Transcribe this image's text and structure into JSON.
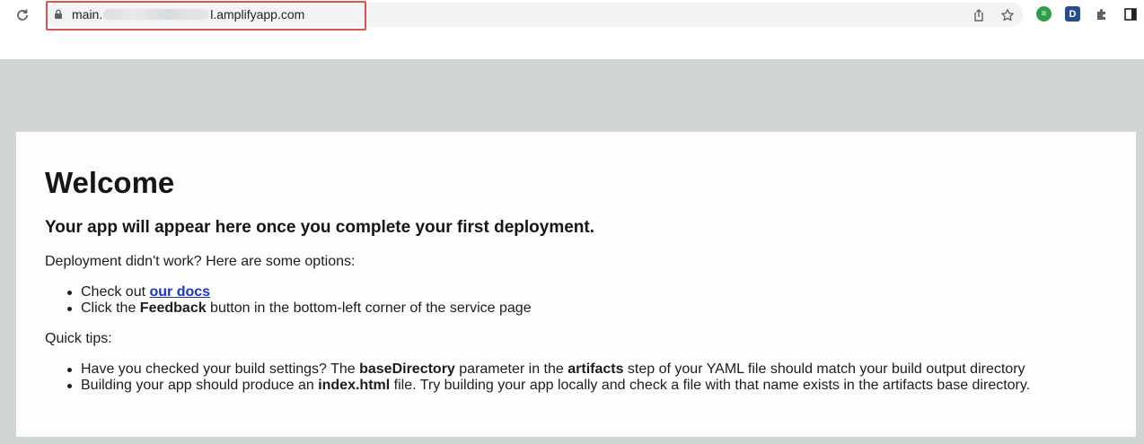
{
  "browser": {
    "url_prefix": "main.",
    "url_suffix": "l.amplifyapp.com"
  },
  "extensions": {
    "d_label": "D",
    "green_label": "≡"
  },
  "page": {
    "title": "Welcome",
    "subtitle": "Your app will appear here once you complete your first deployment.",
    "intro": "Deployment didn't work? Here are some options:",
    "options": {
      "item1_prefix": "Check out ",
      "item1_link": "our docs",
      "item2_prefix": "Click the ",
      "item2_bold": "Feedback",
      "item2_suffix": " button in the bottom-left corner of the service page"
    },
    "tips_heading": "Quick tips:",
    "tips": {
      "item1_a": "Have you checked your build settings? The ",
      "item1_b": "baseDirectory",
      "item1_c": " parameter in the ",
      "item1_d": "artifacts",
      "item1_e": " step of your YAML file should match your build output directory",
      "item2_a": "Building your app should produce an ",
      "item2_b": "index.html",
      "item2_c": " file. Try building your app locally and check a file with that name exists in the artifacts base directory."
    }
  }
}
